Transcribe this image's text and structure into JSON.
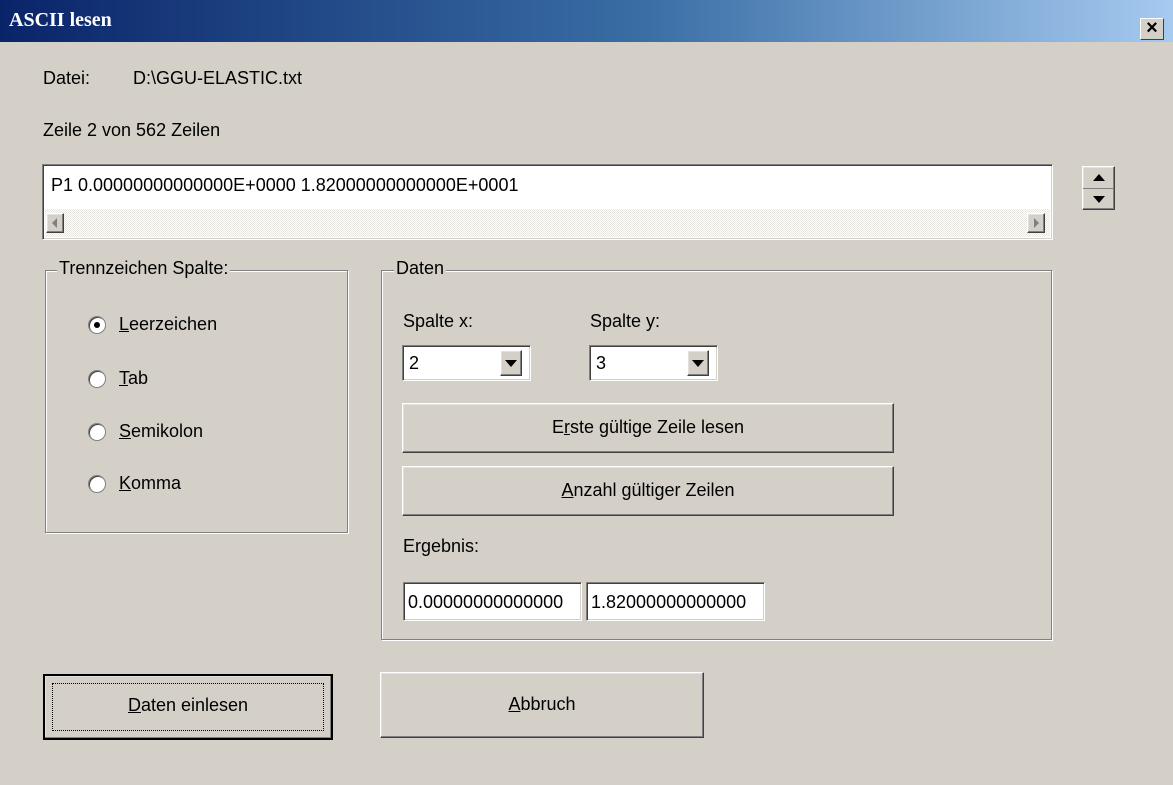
{
  "window": {
    "title": "ASCII lesen",
    "close_glyph": "×"
  },
  "file": {
    "label": "Datei:",
    "path": "D:\\GGU-ELASTIC.txt"
  },
  "line_info": "Zeile 2 von 562 Zeilen",
  "preview_line": "P1  0.00000000000000E+0000  1.82000000000000E+0001",
  "separator_group": {
    "legend": "Trennzeichen Spalte:",
    "options": [
      {
        "mnemonic": "L",
        "rest": "eerzeichen",
        "checked": true
      },
      {
        "mnemonic": "T",
        "rest": "ab",
        "checked": false
      },
      {
        "mnemonic": "S",
        "rest": "emikolon",
        "checked": false
      },
      {
        "mnemonic": "K",
        "rest": "omma",
        "checked": false
      }
    ]
  },
  "data_group": {
    "legend": "Daten",
    "col_x_label": "Spalte x:",
    "col_x_value": "2",
    "col_y_label": "Spalte y:",
    "col_y_value": "3",
    "first_line_btn": {
      "pre": "E",
      "mnemonic": "r",
      "post": "ste gültige Zeile lesen"
    },
    "count_btn": {
      "pre": "",
      "mnemonic": "A",
      "post": "nzahl gültiger Zeilen"
    },
    "result_label": "Ergebnis:",
    "result_x": "0.00000000000000",
    "result_y": "1.82000000000000"
  },
  "buttons": {
    "ok": {
      "mnemonic": "D",
      "rest": "aten einlesen"
    },
    "cancel": {
      "mnemonic": "A",
      "rest": "bbruch"
    }
  },
  "icons": {
    "spin_up": "triangle-up",
    "spin_down": "triangle-down",
    "scroll_left": "triangle-left",
    "scroll_right": "triangle-right",
    "combo_arrow": "triangle-down"
  }
}
